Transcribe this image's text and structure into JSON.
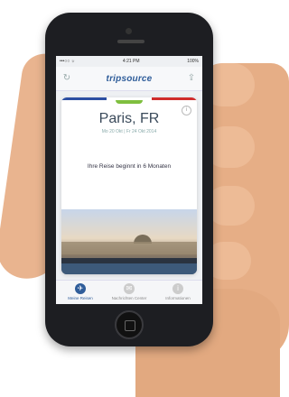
{
  "status": {
    "carrier": "•••○○ ☼",
    "time": "4:21 PM",
    "battery": "100%"
  },
  "navbar": {
    "logo": "tripsource"
  },
  "trip": {
    "city": "Paris, FR",
    "dates": "Mo 20 Okt | Fr 24 Okt 2014",
    "message": "Ihre Reise beginnt in 6 Monaten"
  },
  "tabs": [
    {
      "label": "Meine Reisen"
    },
    {
      "label": "Nachrichten Center"
    },
    {
      "label": "Informationen"
    }
  ],
  "colors": {
    "flag_blue": "#2b4ea2",
    "flag_white": "#ffffff",
    "flag_red": "#d02b2b",
    "tab_green": "#7fbf3f",
    "accent": "#2f5d9a"
  }
}
